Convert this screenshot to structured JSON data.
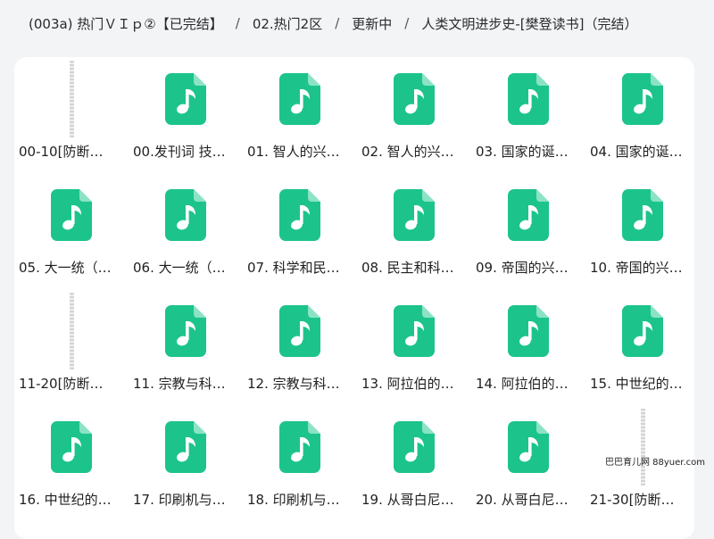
{
  "breadcrumb": {
    "parts": [
      "(003a) 热门ＶＩｐ②【已完结】",
      "02.热门2区",
      "更新中",
      "人类文明进步史-[樊登读书]（完结）"
    ],
    "separator": "/"
  },
  "colors": {
    "audio_icon": "#1cc48c",
    "panel": "#ffffff",
    "background": "#f3f4f6"
  },
  "items": [
    {
      "type": "folder",
      "icon": "folder-thumbnail",
      "name": "00-10[防断…"
    },
    {
      "type": "audio",
      "icon": "music-file-icon",
      "name": "00.发刊词 技…"
    },
    {
      "type": "audio",
      "icon": "music-file-icon",
      "name": "01. 智人的兴…"
    },
    {
      "type": "audio",
      "icon": "music-file-icon",
      "name": "02. 智人的兴…"
    },
    {
      "type": "audio",
      "icon": "music-file-icon",
      "name": "03. 国家的诞…"
    },
    {
      "type": "audio",
      "icon": "music-file-icon",
      "name": "04. 国家的诞…"
    },
    {
      "type": "audio",
      "icon": "music-file-icon",
      "name": "05. 大一统（…"
    },
    {
      "type": "audio",
      "icon": "music-file-icon",
      "name": "06. 大一统（…"
    },
    {
      "type": "audio",
      "icon": "music-file-icon",
      "name": "07. 科学和民…"
    },
    {
      "type": "audio",
      "icon": "music-file-icon",
      "name": "08. 民主和科…"
    },
    {
      "type": "audio",
      "icon": "music-file-icon",
      "name": "09. 帝国的兴…"
    },
    {
      "type": "audio",
      "icon": "music-file-icon",
      "name": "10. 帝国的兴…"
    },
    {
      "type": "folder",
      "icon": "folder-thumbnail",
      "name": "11-20[防断…"
    },
    {
      "type": "audio",
      "icon": "music-file-icon",
      "name": "11. 宗教与科…"
    },
    {
      "type": "audio",
      "icon": "music-file-icon",
      "name": "12. 宗教与科…"
    },
    {
      "type": "audio",
      "icon": "music-file-icon",
      "name": "13. 阿拉伯的…"
    },
    {
      "type": "audio",
      "icon": "music-file-icon",
      "name": "14. 阿拉伯的…"
    },
    {
      "type": "audio",
      "icon": "music-file-icon",
      "name": "15. 中世纪的…"
    },
    {
      "type": "audio",
      "icon": "music-file-icon",
      "name": "16. 中世纪的…"
    },
    {
      "type": "audio",
      "icon": "music-file-icon",
      "name": "17. 印刷机与…"
    },
    {
      "type": "audio",
      "icon": "music-file-icon",
      "name": "18. 印刷机与…"
    },
    {
      "type": "audio",
      "icon": "music-file-icon",
      "name": "19. 从哥白尼…"
    },
    {
      "type": "audio",
      "icon": "music-file-icon",
      "name": "20. 从哥白尼…"
    },
    {
      "type": "folder",
      "icon": "folder-thumbnail",
      "name": "21-30[防断…"
    }
  ],
  "watermark": "巴巴育儿网 88yuer.com"
}
